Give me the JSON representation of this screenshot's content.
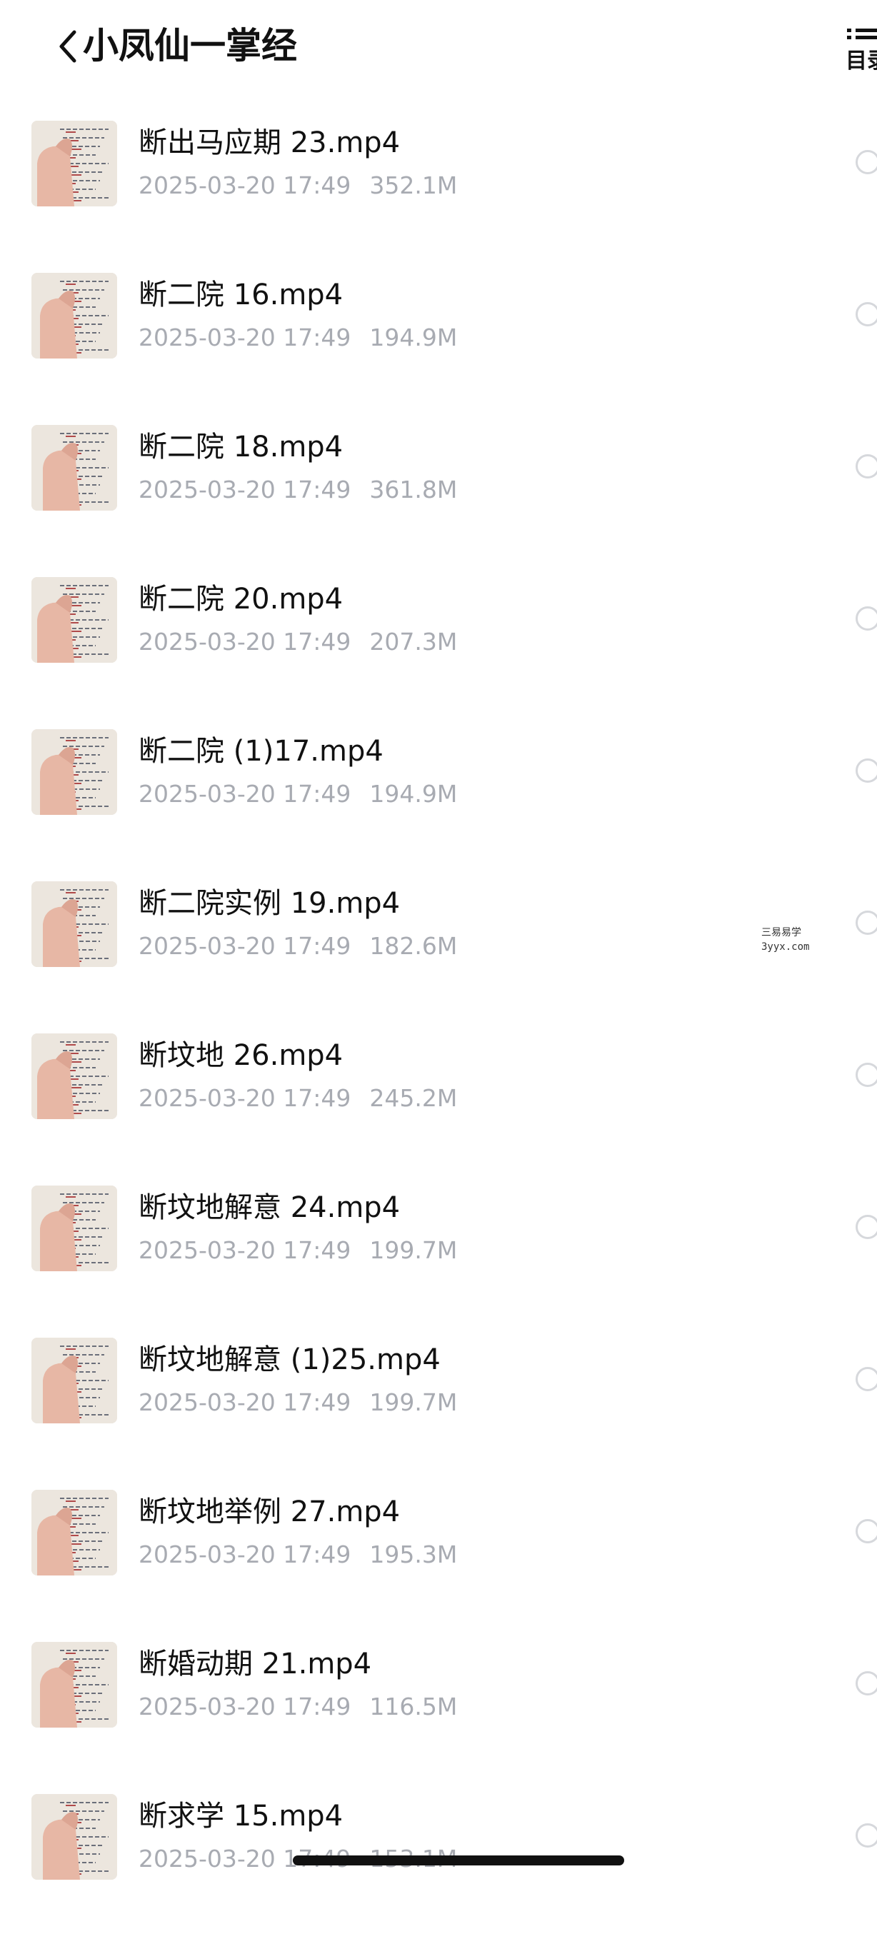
{
  "header": {
    "title": "小凤仙一掌经",
    "back_icon": "chevron-left-icon",
    "toc_icon": "list-icon",
    "toc_label": "目录"
  },
  "files": [
    {
      "name": "断出马应期 23.mp4",
      "date": "2025-03-20 17:49",
      "size": "352.1M"
    },
    {
      "name": "断二院 16.mp4",
      "date": "2025-03-20 17:49",
      "size": "194.9M"
    },
    {
      "name": "断二院 18.mp4",
      "date": "2025-03-20 17:49",
      "size": "361.8M"
    },
    {
      "name": "断二院 20.mp4",
      "date": "2025-03-20 17:49",
      "size": "207.3M"
    },
    {
      "name": "断二院 (1)17.mp4",
      "date": "2025-03-20 17:49",
      "size": "194.9M"
    },
    {
      "name": "断二院实例 19.mp4",
      "date": "2025-03-20 17:49",
      "size": "182.6M"
    },
    {
      "name": "断坟地 26.mp4",
      "date": "2025-03-20 17:49",
      "size": "245.2M"
    },
    {
      "name": "断坟地解意 24.mp4",
      "date": "2025-03-20 17:49",
      "size": "199.7M"
    },
    {
      "name": "断坟地解意 (1)25.mp4",
      "date": "2025-03-20 17:49",
      "size": "199.7M"
    },
    {
      "name": "断坟地举例 27.mp4",
      "date": "2025-03-20 17:49",
      "size": "195.3M"
    },
    {
      "name": "断婚动期 21.mp4",
      "date": "2025-03-20 17:49",
      "size": "116.5M"
    },
    {
      "name": "断求学 15.mp4",
      "date": "2025-03-20 17:49",
      "size": "153.1M"
    }
  ],
  "watermark": {
    "line1": "三易易学",
    "line2": "3yyx.com"
  }
}
